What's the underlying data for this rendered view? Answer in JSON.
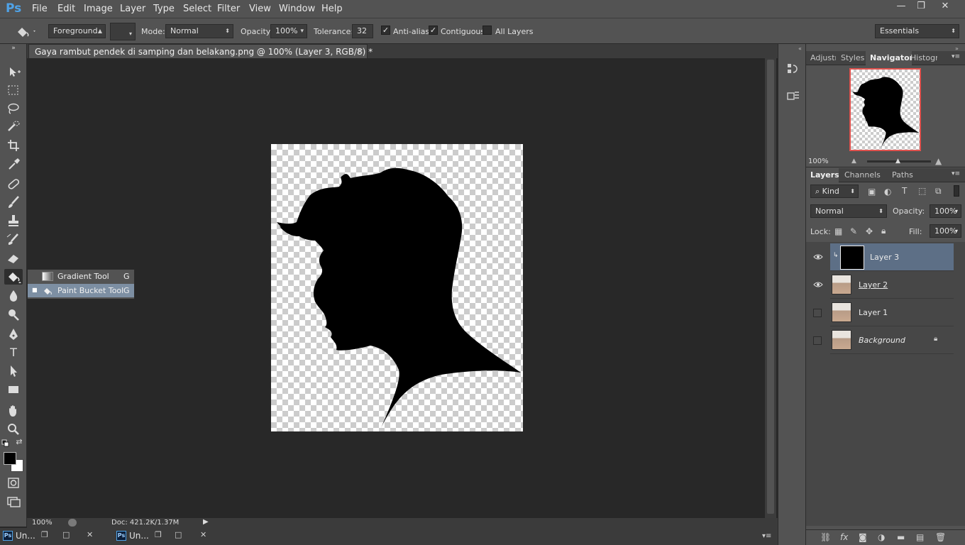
{
  "app": {
    "logo": "Ps"
  },
  "menu": [
    "File",
    "Edit",
    "Image",
    "Layer",
    "Type",
    "Select",
    "Filter",
    "View",
    "Window",
    "Help"
  ],
  "window_controls": {
    "minimize": "—",
    "restore": "❐",
    "close": "✕"
  },
  "options": {
    "fill_source": "Foreground",
    "mode_label": "Mode:",
    "mode_value": "Normal",
    "opacity_label": "Opacity:",
    "opacity_value": "100%",
    "tolerance_label": "Tolerance:",
    "tolerance_value": "32",
    "anti_alias": "Anti-alias",
    "contiguous": "Contiguous",
    "all_layers": "All Layers",
    "workspace": "Essentials"
  },
  "document": {
    "tab_title": "Gaya rambut pendek di samping dan belakang.png @ 100% (Layer 3, RGB/8) *",
    "close": "×",
    "zoom": "100%",
    "doc_info": "Doc: 421.2K/1.37M"
  },
  "flyout": [
    {
      "label": "Gradient Tool",
      "key": "G"
    },
    {
      "label": "Paint Bucket Tool",
      "key": "G"
    }
  ],
  "minimized_docs": [
    {
      "name": "Un..."
    },
    {
      "name": "Un..."
    }
  ],
  "navigator": {
    "tabs": [
      "Adjustı",
      "Styles",
      "Navigator",
      "Histogr"
    ],
    "zoom": "100%"
  },
  "layers_panel": {
    "tabs": [
      "Layers",
      "Channels",
      "Paths"
    ],
    "filter_kind": "Kind",
    "blend_mode": "Normal",
    "opacity_label": "Opacity:",
    "opacity_value": "100%",
    "lock_label": "Lock:",
    "fill_label": "Fill:",
    "fill_value": "100%",
    "layers": [
      {
        "name": "Layer 3",
        "visible": true,
        "selected": true
      },
      {
        "name": "Layer 2",
        "visible": true,
        "selected": false
      },
      {
        "name": "Layer 1",
        "visible": false,
        "selected": false
      },
      {
        "name": "Background",
        "visible": false,
        "selected": false,
        "locked": true
      }
    ]
  },
  "colors": {
    "accent": "#4fa3e8",
    "selected_row": "#5d6f86",
    "flyout_selected": "#7d8fa3",
    "panel_bg": "#535353",
    "canvas_bg": "#282828"
  }
}
